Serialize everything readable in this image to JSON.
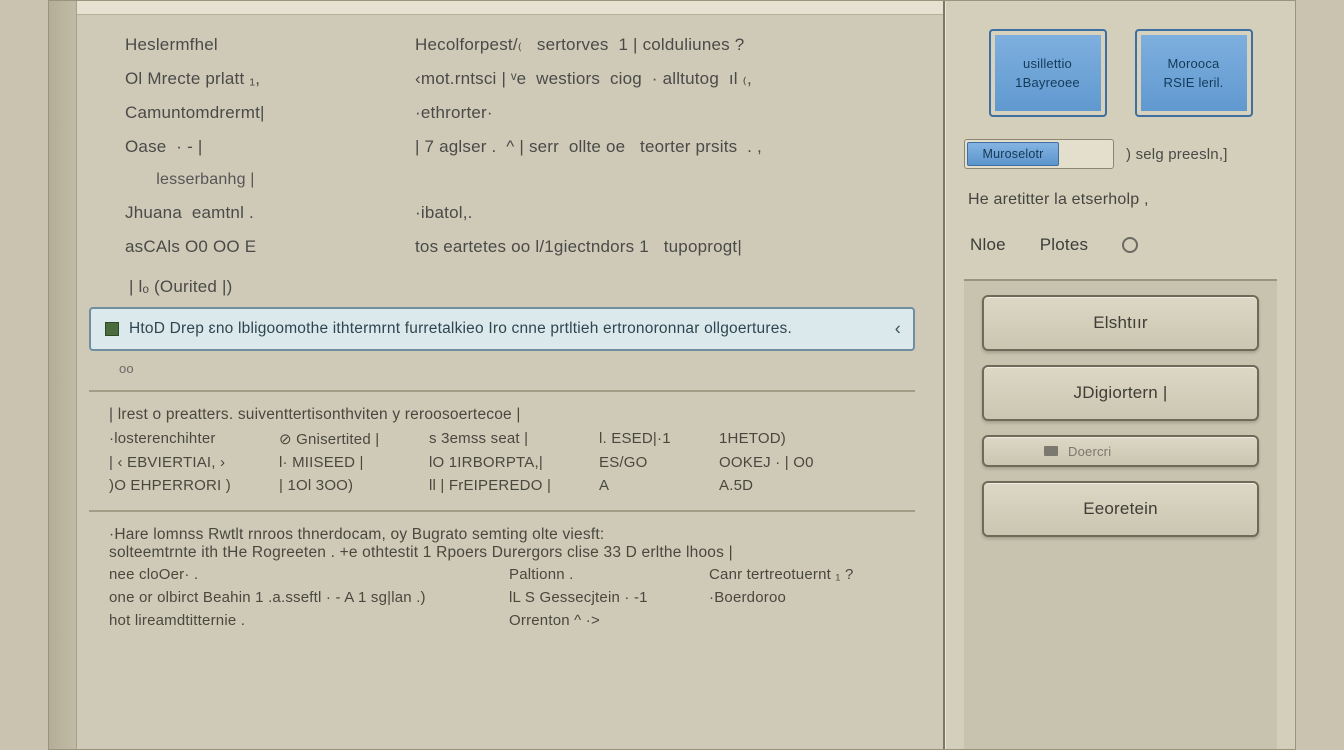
{
  "defs": [
    {
      "term": "Heslermfhel",
      "val": "Hecolforpest/₍   sertorves  1 | colduliunes ?"
    },
    {
      "term": "Ol Mrecte prlatt ₁,",
      "val": "‹mot.rntsci | ᵛe  westiors  ciog  · alltutog  ıl ₍,"
    },
    {
      "term": "Camuntomdrermt|",
      "val": "·ethrorter·"
    },
    {
      "term": "Oase  · - |",
      "val": "| 7 aglser .  ^ | serr  ollte oe   teorter prsits  . ,"
    },
    {
      "term": "  lesserbanhg |",
      "val": ""
    },
    {
      "term": "Jhuana  eamtnl .",
      "val": "·ibatol,."
    },
    {
      "term": "asCAls O0 OO E",
      "val": "tos eartetes oo l/1giectndors 1   tupoprogt|"
    }
  ],
  "orphan_term": "| lₒ (Ourited |)",
  "banner": {
    "text": "HtoD Drep ɛno lbligoomothe ithtermrnt furretalkieo Iro cnne prtltieh ertronoronnar ollgoertures."
  },
  "tiny": "oo",
  "panel1": {
    "title": "| lrest o preatters. suiventtertisonthviten y reroosoertecoe |",
    "rows": [
      [
        "·losterenchihter",
        "⊘ Gnisertited |",
        "s  3emss seat |",
        "l.  ESED|·1",
        "1HETOD)"
      ],
      [
        "| ‹ EBVIERTIAI, ›",
        "l·   MIISEED |",
        "lO 1IRBORPTA,|",
        "ES/GO",
        "OOKEJ · | O0"
      ],
      [
        ")O EHPERRORI )",
        "| 1Ol 3OO)",
        "ll  | FrEIPEREDO |",
        "A",
        "A.5D"
      ]
    ]
  },
  "panel2": {
    "lines": [
      "·Hare  lomnss  Rwtlt   rnroos  thnerdocam,  oy Bugrato  semting  olte viesft:",
      "solteemtrnte ith tHe  Rogreeten .  +e  othtestit  1 Rpoers  Durergors  clise  33  D   erlthe lhoos |"
    ],
    "row1": [
      "nee cloOer· .",
      "Paltionn .",
      "Canr tertreotuernt ₁ ?"
    ],
    "row2": [
      "one  or olbirct Beahin  1  .a.sseftl · - A  1 sg|lan .)",
      "lL S  Gessecjtein  · -1",
      "·Boerdoroo"
    ],
    "row3": [
      "   hot lireamdtitternie .",
      "Orrenton  ^ ·>",
      ""
    ]
  },
  "side": {
    "tiles": [
      {
        "l1": "usillettio",
        "l2": "1Bayreoee"
      },
      {
        "l1": "Morooca",
        "l2": "RSIE leril."
      }
    ],
    "toggle_on": "Muroselotr",
    "toggle_rest": "",
    "preset_lbl": ") selg preesln,]",
    "note": "He  aretitter  la etserholp ,",
    "tabs": [
      "Nloe",
      "Plotes"
    ],
    "buttons": [
      "Elshtıır",
      "JDigiortern |",
      "Eeoretein"
    ],
    "dim_btn": "Doercri"
  }
}
